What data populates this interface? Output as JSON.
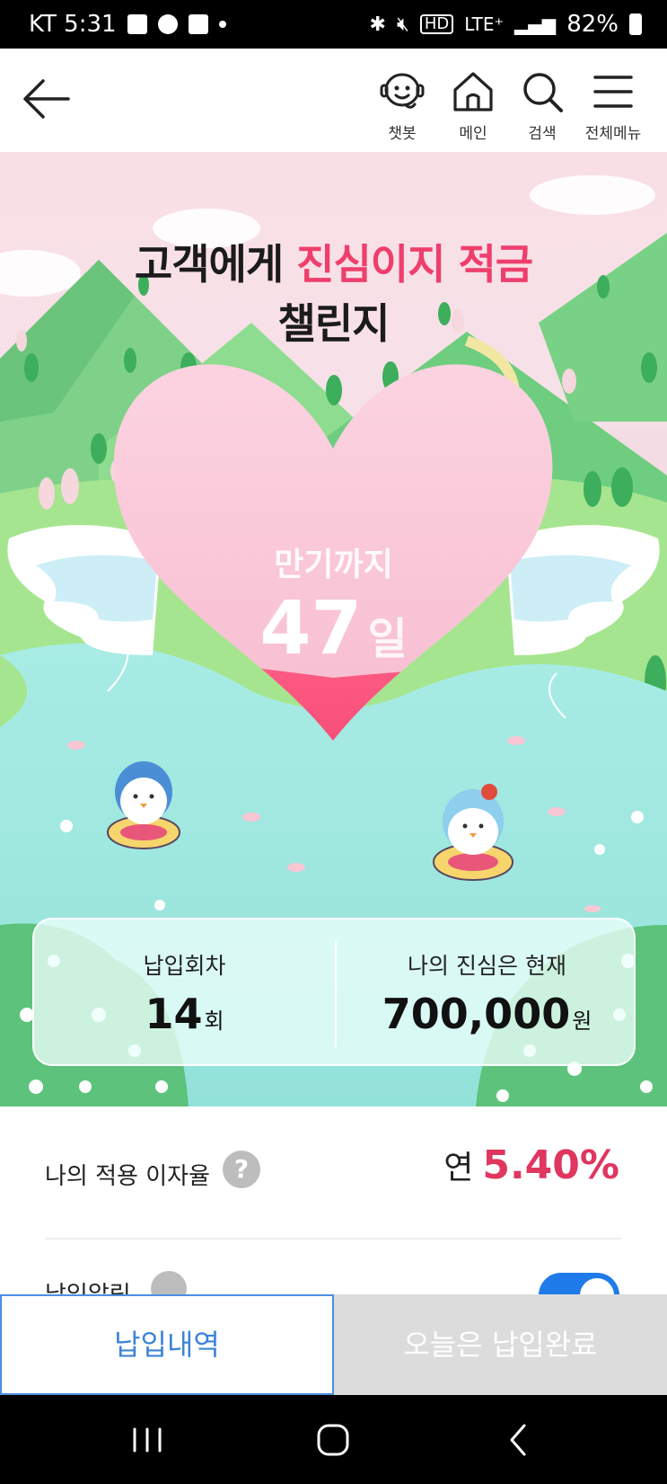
{
  "status_bar": {
    "carrier_time": "KT 5:31",
    "hd": "HD",
    "network": "LTE⁺",
    "battery": "82%"
  },
  "header": {
    "nav": [
      {
        "label": "챗봇",
        "icon": "chatbot-icon"
      },
      {
        "label": "메인",
        "icon": "home-icon"
      },
      {
        "label": "검색",
        "icon": "search-icon"
      },
      {
        "label": "전체메뉴",
        "icon": "menu-icon"
      }
    ]
  },
  "hero": {
    "title_part1": "고객에게 ",
    "title_accent": "진심이지 적금",
    "title_line2": "챌린지",
    "heart_label": "만기까지",
    "days": "47",
    "days_unit": "일",
    "heart_fill_fraction": 0.22
  },
  "stats": {
    "count_label": "납입회차",
    "count_value": "14",
    "count_unit": "회",
    "amount_label": "나의 진심은 현재",
    "amount_value": "700,000",
    "amount_unit": "원"
  },
  "interest": {
    "label": "나의 적용 이자율",
    "help": "?",
    "prefix": "연",
    "value": "5.40%"
  },
  "auto_deposit": {
    "label": "납입알림",
    "toggle_on": true
  },
  "buttons": {
    "history": "납입내역",
    "done": "오늘은 납입완료"
  },
  "colors": {
    "accent": "#ee3f6c",
    "rate": "#e0365f",
    "primary_blue": "#1f7bea",
    "disabled_gray": "#dcdcdc"
  }
}
